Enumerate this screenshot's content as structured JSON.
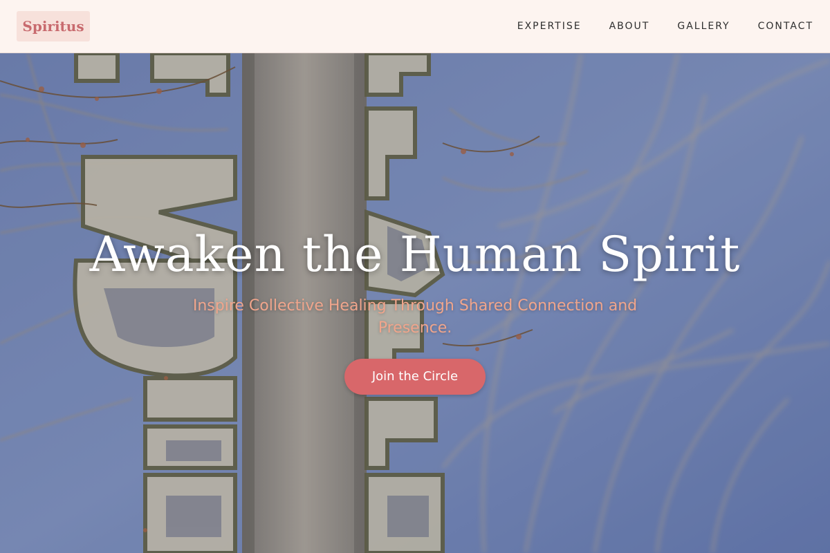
{
  "header": {
    "logo": "Spiritus",
    "nav": [
      "EXPERTISE",
      "ABOUT",
      "GALLERY",
      "CONTACT"
    ]
  },
  "hero": {
    "title": "Awaken the Human Spirit",
    "subtitle": "Inspire Collective Healing Through Shared Connection and Presence.",
    "cta_label": "Join the Circle"
  },
  "colors": {
    "header_bg": "#fdf4f0",
    "logo_text": "#c86a6e",
    "logo_bg": "#f7e1db",
    "subtitle": "#f0a58c",
    "cta_bg": "#d8676a",
    "sky": "#6f86b8"
  }
}
